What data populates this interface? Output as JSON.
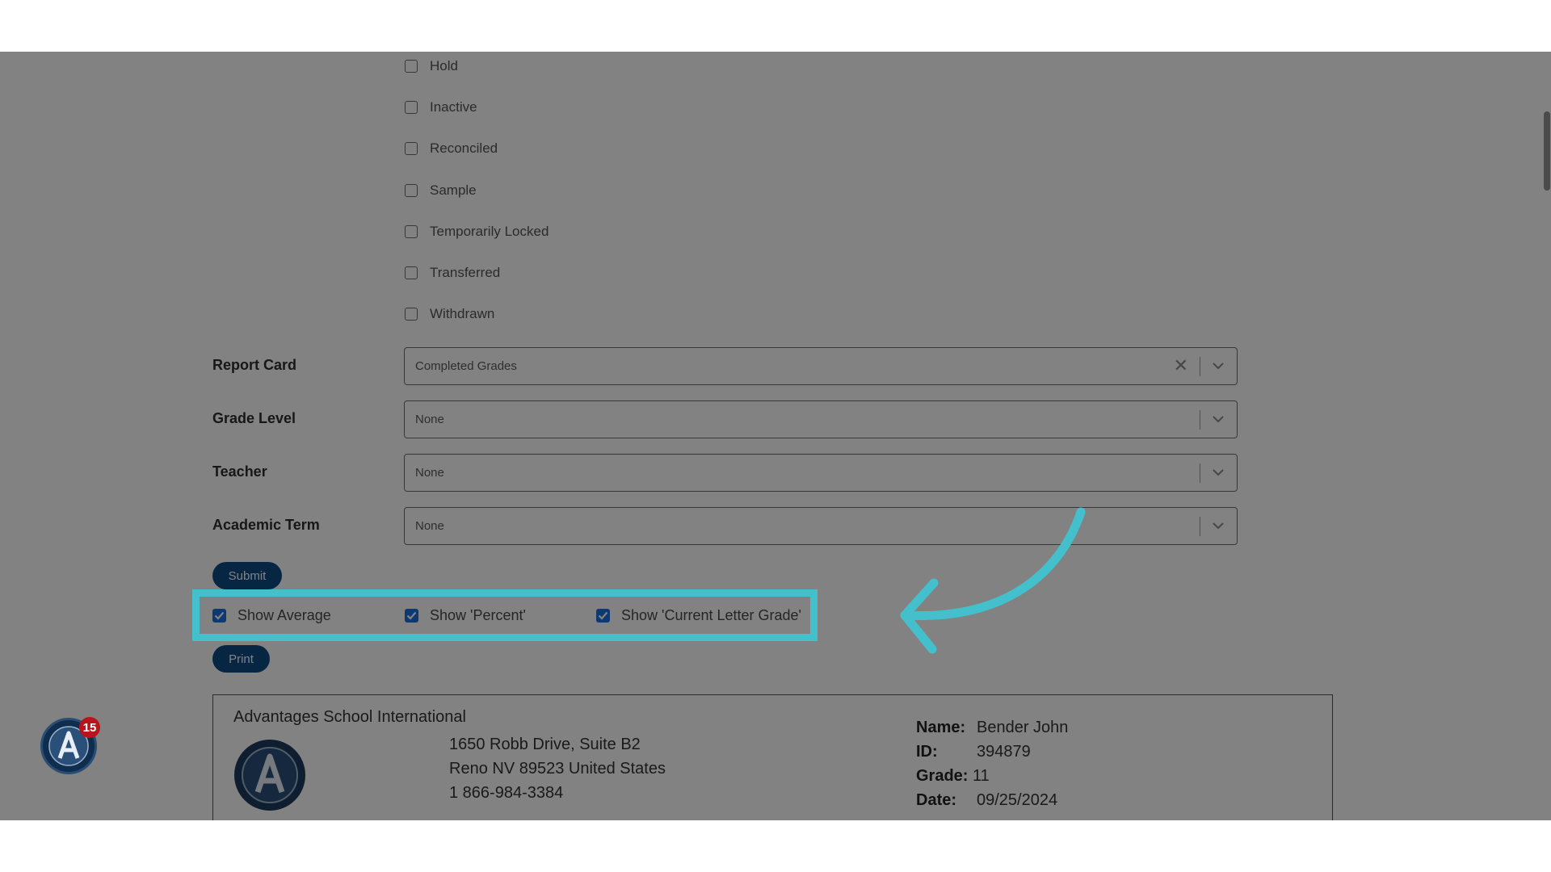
{
  "status_checkboxes": [
    {
      "label": "Hold",
      "checked": false
    },
    {
      "label": "Inactive",
      "checked": false
    },
    {
      "label": "Reconciled",
      "checked": false
    },
    {
      "label": "Sample",
      "checked": false
    },
    {
      "label": "Temporarily Locked",
      "checked": false
    },
    {
      "label": "Transferred",
      "checked": false
    },
    {
      "label": "Withdrawn",
      "checked": false
    }
  ],
  "form": {
    "report_card": {
      "label": "Report Card",
      "value": "Completed Grades"
    },
    "grade_level": {
      "label": "Grade Level",
      "value": "None"
    },
    "teacher": {
      "label": "Teacher",
      "value": "None"
    },
    "academic_term": {
      "label": "Academic Term",
      "value": "None"
    },
    "clear_glyph": "✕"
  },
  "buttons": {
    "submit": "Submit",
    "print": "Print"
  },
  "options": [
    {
      "label": "Show Average",
      "checked": true
    },
    {
      "label": "Show 'Percent'",
      "checked": true
    },
    {
      "label": "Show 'Current Letter Grade'",
      "checked": true
    }
  ],
  "report": {
    "school_name": "Advantages School International",
    "address_lines": [
      "1650 Robb Drive, Suite B2",
      "Reno NV 89523 United States",
      "1 866-984-3384"
    ],
    "student": {
      "name_label": "Name:",
      "name": "Bender John",
      "id_label": "ID:",
      "id": "394879",
      "grade_label": "Grade:",
      "grade": "11",
      "date_label": "Date:",
      "date": "09/25/2024"
    }
  },
  "help_widget": {
    "badge_count": "15",
    "icon": "advantages-logo-icon"
  },
  "colors": {
    "accent": "#0d4b86",
    "highlight": "#44c0cc",
    "checkbox": "#1b6fe0",
    "badge": "#b7151b"
  }
}
